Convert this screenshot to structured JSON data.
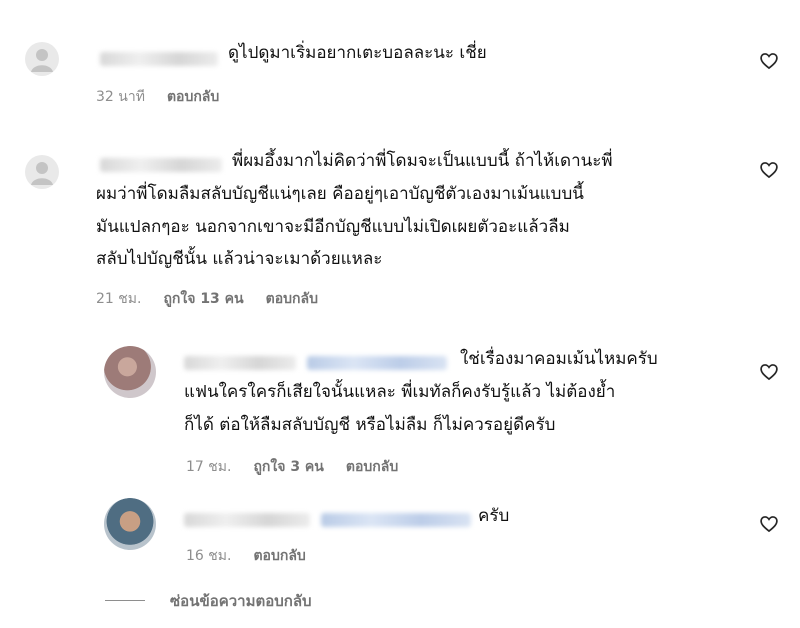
{
  "comments": [
    {
      "text": "ดูไปดูมาเริ่มอยากเตะบอลละนะ เชี่ย",
      "time": "32 นาที",
      "reply_label": "ตอบกลับ"
    },
    {
      "line1": "พี่ผมอึ้งมากไม่คิดว่าพี่โดมจะเป็นแบบนี้ ถ้าไห้เดานะพี่",
      "line2": "ผมว่าพี่โดมลืมสลับบัญชีแน่ๆเลย คืออยู่ๆเอาบัญชีตัวเองมาเม้นแบบนี้",
      "line3": "มันแปลกๆอะ นอกจากเขาจะมีอีกบัญชีแบบไม่เปิดเผยตัวอะแล้วลืม",
      "line4": "สลับไปบัญชีนั้น แล้วน่าจะเมาด้วยแหละ",
      "time": "21 ชม.",
      "likes": "ถูกใจ 13 คน",
      "reply_label": "ตอบกลับ"
    }
  ],
  "replies": [
    {
      "line1": "ใช่เรื่องมาคอมเม้นไหมครับ",
      "line2": "แฟนใครใครก็เสียใจนั้นแหละ พี่เมทัลก็คงรับรู้แล้ว ไม่ต้องย้ำ",
      "line3": "ก็ได้ ต่อให้ลืมสลับบัญชี หรือไม่ลืม ก็ไม่ควรอยู่ดีครับ",
      "time": "17 ชม.",
      "likes": "ถูกใจ 3 คน",
      "reply_label": "ตอบกลับ"
    },
    {
      "text": "ครับ",
      "time": "16 ชม.",
      "reply_label": "ตอบกลับ"
    }
  ],
  "hide_replies_label": "ซ่อนข้อความตอบกลับ",
  "icons": {
    "like": "heart-outline-icon",
    "avatar": "user-silhouette-icon"
  },
  "colors": {
    "text": "#111111",
    "meta": "#8e8e8e",
    "mention": "#00376b"
  }
}
